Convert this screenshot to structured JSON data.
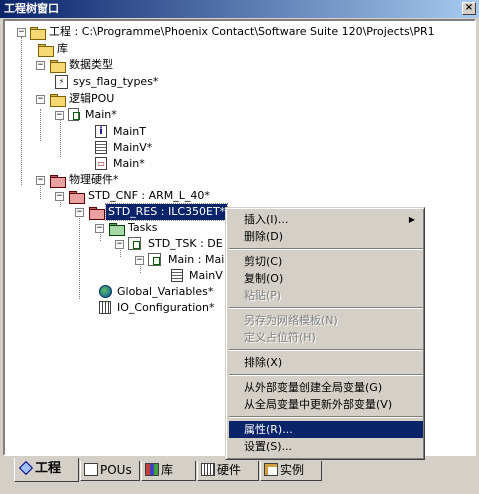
{
  "window": {
    "title": "工程树窗口",
    "close_glyph": "×"
  },
  "tree": {
    "project": "工程 : C:\\Programme\\Phoenix Contact\\Software Suite 120\\Projects\\PR1",
    "lib": "库",
    "datatypes": "数据类型",
    "sys_flag_types": "sys_flag_types*",
    "logic_pou": "逻辑POU",
    "main_pou": "Main*",
    "main_t": "MainT",
    "main_v": "MainV*",
    "main_code": "Main*",
    "hardware": "物理硬件*",
    "std_cnf": "STD_CNF : ARM_L_40*",
    "std_res": "STD_RES : ILC350ET*",
    "tasks": "Tasks",
    "std_tsk": "STD_TSK : DE",
    "main_main": "Main : Main",
    "main_v2": "MainV",
    "global_vars": "Global_Variables*",
    "io_config": "IO_Configuration*"
  },
  "context_menu": {
    "insert": "插入(I)...",
    "delete": "删除(D)",
    "cut": "剪切(C)",
    "copy": "复制(O)",
    "paste": "粘贴(P)",
    "save_as_template": "另存为网络模板(N)",
    "define_placeholder": "定义占位符(H)",
    "exclude": "排除(X)",
    "create_globals": "从外部变量创建全局变量(G)",
    "update_externals": "从全局变量中更新外部变量(V)",
    "properties": "属性(R)...",
    "settings": "设置(S)..."
  },
  "tabs": [
    {
      "label": "工程",
      "icon": "project-icon"
    },
    {
      "label": "POUs",
      "icon": "pou-icon"
    },
    {
      "label": "库",
      "icon": "library-icon"
    },
    {
      "label": "硬件",
      "icon": "hardware-icon"
    },
    {
      "label": "实例",
      "icon": "instance-icon"
    }
  ],
  "colors": {
    "selection": "#0a246a",
    "face": "#d4d0c8",
    "title_start": "#0a246a",
    "title_end": "#a6caf0"
  }
}
